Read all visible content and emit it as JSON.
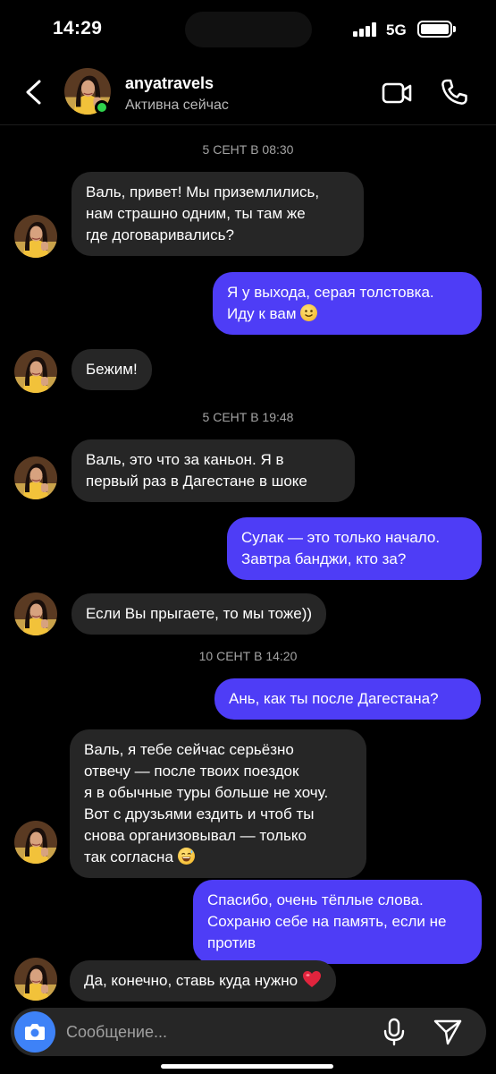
{
  "status_bar": {
    "time": "14:29",
    "network": "5G",
    "battery": 1.0
  },
  "header": {
    "username": "anyatravels",
    "activity": "Активна сейчас",
    "online": true,
    "icons": [
      "chevron-left-icon",
      "video-camera-icon",
      "phone-icon"
    ]
  },
  "conversation": {
    "timestamps": [
      "5 СЕНТ В 08:30",
      "5 СЕНТ В 19:48",
      "10 СЕНТ В 14:20"
    ],
    "messages": [
      {
        "from": "them",
        "text": "Валь, привет! Мы приземлились,\nнам страшно одним, ты там же\nгде договаривались?"
      },
      {
        "from": "me",
        "text": "Я у выхода, серая толстовка.\nИду к вам",
        "emoji": "slightly-smiling-face"
      },
      {
        "from": "them",
        "text": "Бежим!"
      },
      {
        "from": "them",
        "text": "Валь, это что за каньон. Я в\nпервый раз в Дагестане в шоке"
      },
      {
        "from": "me",
        "text": "Сулак — это только начало.\nЗавтра банджи, кто за?"
      },
      {
        "from": "them",
        "text": "Если Вы прыгаете, то мы тоже))"
      },
      {
        "from": "me",
        "text": "Ань, как ты после Дагестана?"
      },
      {
        "from": "them",
        "text": "Валь, я тебе сейчас серьёзно\nотвечу — после твоих поездок\nя в обычные туры больше не хочу.\nВот с друзьями ездить и чтоб ты\nснова организовывал — только\nтак согласна",
        "emoji": "grinning-sweat-face"
      },
      {
        "from": "me",
        "text": "Спасибо, очень тёплые слова.\nСохраню себе на память, если не\nпротив"
      },
      {
        "from": "them",
        "text": "Да, конечно, ставь куда нужно",
        "emoji": "red-heart"
      }
    ]
  },
  "composer": {
    "placeholder": "Сообщение...",
    "icons": [
      "camera-icon",
      "microphone-icon",
      "send-icon"
    ]
  },
  "colors": {
    "background": "#000000",
    "incoming_bubble": "#262626",
    "outgoing_bubble": "#4e3df6",
    "online": "#2fd34d",
    "camera_button": "#3e82f7"
  }
}
